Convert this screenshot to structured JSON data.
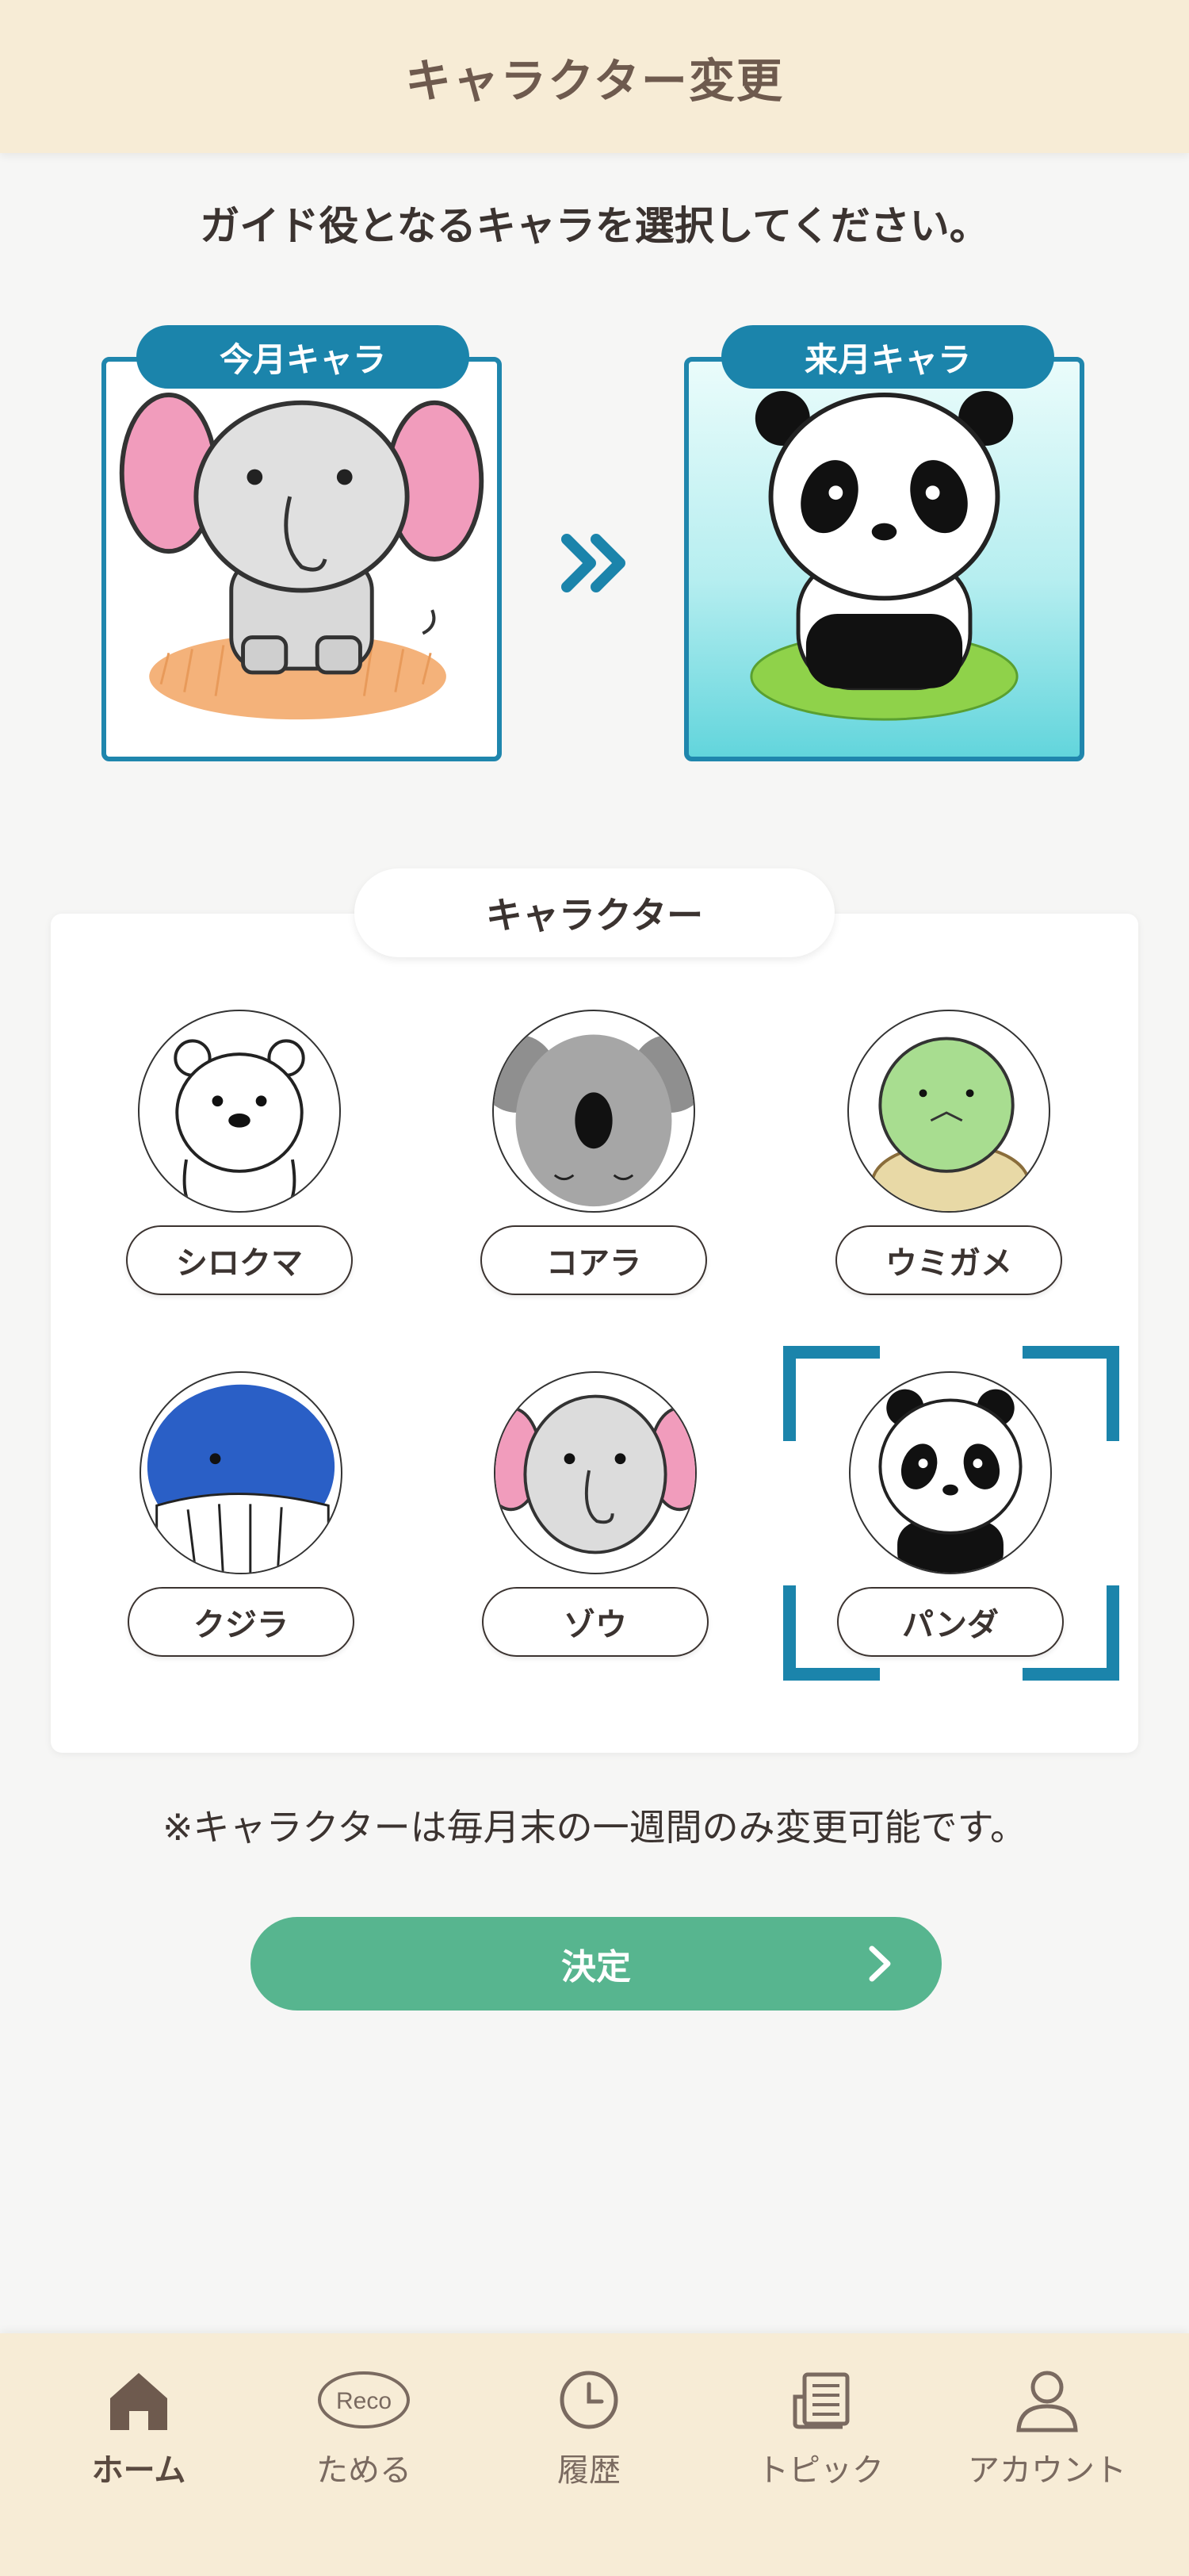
{
  "header": {
    "title": "キャラクター変更"
  },
  "instruction": "ガイド役となるキャラを選択してください。",
  "current": {
    "label": "今月キャラ",
    "character": "elephant"
  },
  "next": {
    "label": "来月キャラ",
    "character": "panda"
  },
  "panel": {
    "title": "キャラクター",
    "options": [
      {
        "label": "シロクマ",
        "character": "polar-bear",
        "selected": false
      },
      {
        "label": "コアラ",
        "character": "koala",
        "selected": false
      },
      {
        "label": "ウミガメ",
        "character": "sea-turtle",
        "selected": false
      },
      {
        "label": "クジラ",
        "character": "whale",
        "selected": false
      },
      {
        "label": "ゾウ",
        "character": "elephant",
        "selected": false
      },
      {
        "label": "パンダ",
        "character": "panda",
        "selected": true
      }
    ]
  },
  "note": "※キャラクターは毎月末の一週間のみ変更可能です。",
  "decide": {
    "label": "決定"
  },
  "tabbar": {
    "items": [
      {
        "label": "ホーム",
        "icon": "home-icon",
        "active": true
      },
      {
        "label": "ためる",
        "icon": "reco-icon",
        "icon_text": "Reco",
        "active": false
      },
      {
        "label": "履歴",
        "icon": "clock-icon",
        "active": false
      },
      {
        "label": "トピック",
        "icon": "newspaper-icon",
        "active": false
      },
      {
        "label": "アカウント",
        "icon": "person-icon",
        "active": false
      }
    ]
  },
  "colors": {
    "accent": "#1b84ab",
    "button": "#57b58f",
    "header_bg": "#f7ecd6",
    "page_bg": "#f6f6f5"
  }
}
